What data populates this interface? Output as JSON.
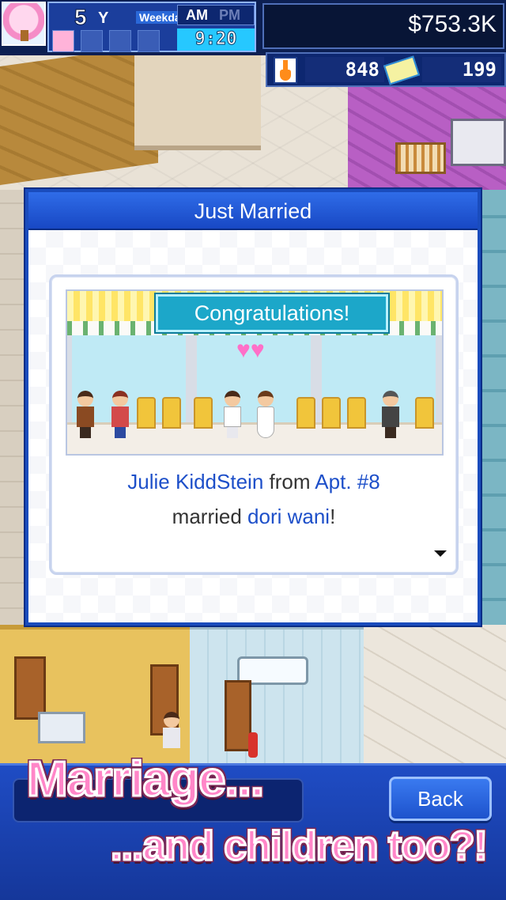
{
  "hud": {
    "year_number": "5",
    "year_unit": "Y",
    "day_type": "Weekday",
    "am_label": "AM",
    "pm_label": "PM",
    "time": "9:20",
    "money": "$753.3K",
    "research_points": "848",
    "tickets": "199",
    "icons": [
      "avatar-icon",
      "flask-icon",
      "ticket-icon"
    ]
  },
  "dialog": {
    "title": "Just Married",
    "banner": "Congratulations!",
    "message": {
      "person_name": "Julie KiddStein",
      "from_word": " from ",
      "apartment": "Apt. #8",
      "married_word": "married ",
      "spouse_name": "dori wani",
      "exclamation": "!"
    }
  },
  "bottom": {
    "back_label": "Back"
  },
  "promo": {
    "line1": "Marriage...",
    "line2": "...and children too?!"
  },
  "colors": {
    "highlight_text": "#1d4fc9",
    "dialog_frame": "#1a4cbd",
    "banner": "#1ca7c9",
    "promo_pink": "#ff86c8"
  }
}
